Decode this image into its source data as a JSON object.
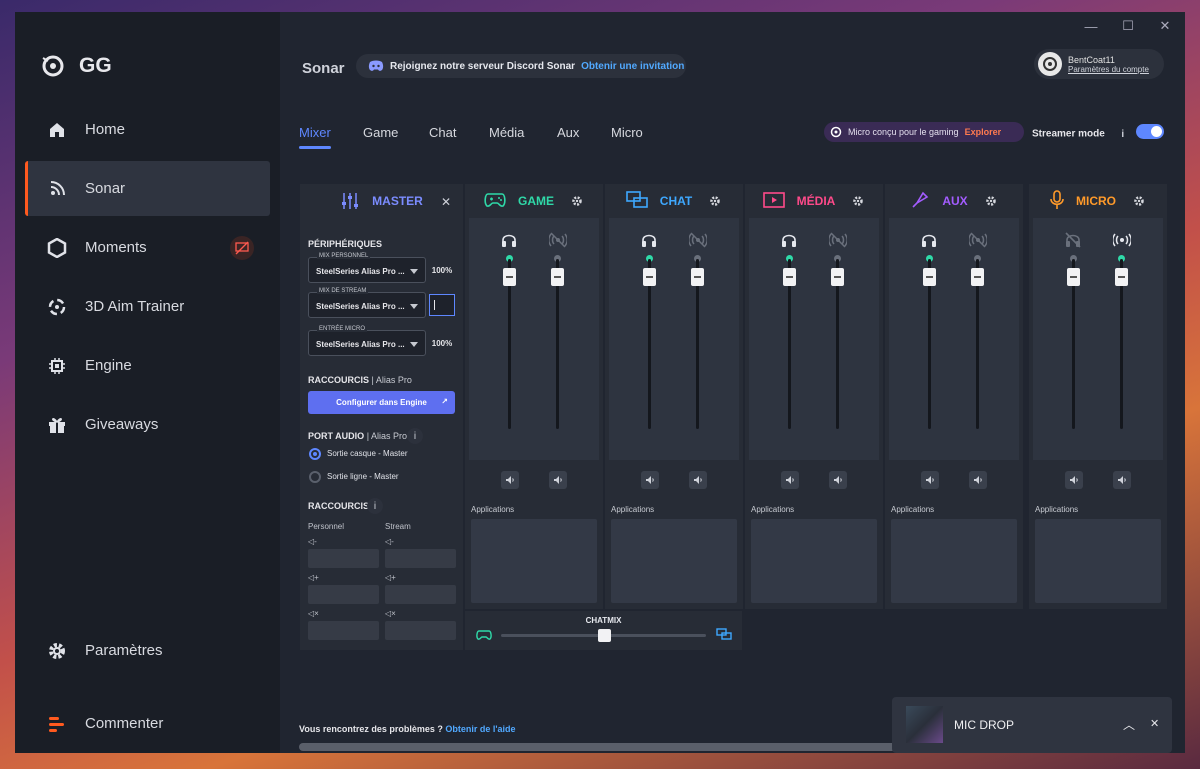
{
  "app": {
    "name": "GG",
    "window_controls": [
      "minimize",
      "maximize",
      "close"
    ]
  },
  "sidebar": {
    "items": [
      {
        "label": "Home",
        "icon": "home-icon"
      },
      {
        "label": "Sonar",
        "icon": "sonar-icon",
        "active": true
      },
      {
        "label": "Moments",
        "icon": "hexagon-icon"
      },
      {
        "label": "3D Aim Trainer",
        "icon": "crosshair-icon"
      },
      {
        "label": "Engine",
        "icon": "chip-icon"
      },
      {
        "label": "Giveaways",
        "icon": "gift-icon"
      }
    ],
    "bottom": [
      {
        "label": "Paramètres",
        "icon": "gear-icon"
      },
      {
        "label": "Commenter",
        "icon": "comment-icon"
      }
    ]
  },
  "header": {
    "title": "Sonar",
    "discord_text": "Rejoignez notre serveur Discord Sonar",
    "discord_link": "Obtenir une invitation",
    "user_name": "BentCoat11",
    "account_link": "Paramètres du compte"
  },
  "tabs": [
    "Mixer",
    "Game",
    "Chat",
    "Média",
    "Aux",
    "Micro"
  ],
  "promo": {
    "text": "Micro conçu pour le gaming",
    "link": "Explorer"
  },
  "streamer_mode": {
    "label": "Streamer mode",
    "info": "i",
    "enabled": true
  },
  "master": {
    "title": "MASTER",
    "peripherals_label": "PÉRIPHÉRIQUES",
    "devices": [
      {
        "caption": "MIX PERSONNEL",
        "value": "SteelSeries Alias Pro ...",
        "percent": "100%"
      },
      {
        "caption": "MIX DE STREAM",
        "value": "SteelSeries Alias Pro ...",
        "percent": ""
      },
      {
        "caption": "ENTRÉE MICRO",
        "value": "SteelSeries Alias Pro ...",
        "percent": "100%"
      }
    ],
    "shortcuts_label": "RACCOURCIS",
    "shortcuts_device": "| Alias Pro",
    "configure_button": "Configurer dans Engine",
    "audio_port_label": "PORT AUDIO",
    "audio_port_device": "| Alias Pro",
    "audio_port_info": "i",
    "ports": [
      {
        "label": "Sortie casque - Master",
        "selected": true
      },
      {
        "label": "Sortie ligne - Master",
        "selected": false
      }
    ],
    "hotkeys_label": "RACCOURCIS",
    "hotkeys_info": "i",
    "col_personal": "Personnel",
    "col_stream": "Stream",
    "hotkey_rows": [
      "vol-down",
      "vol-up",
      "mute"
    ],
    "hotkey_captions": [
      "◁-",
      "◁-",
      "◁+",
      "◁+",
      "◁×",
      "◁×"
    ]
  },
  "channels": [
    {
      "name": "GAME",
      "color": "#2fd9a8",
      "dots": [
        "#2fd9a8",
        "#6a707c"
      ],
      "icon": "gamepad-icon"
    },
    {
      "name": "CHAT",
      "color": "#3ea8ff",
      "dots": [
        "#2fd9a8",
        "#6a707c"
      ],
      "icon": "chat-icon"
    },
    {
      "name": "MÉDIA",
      "color": "#ff4a8a",
      "dots": [
        "#2fd9a8",
        "#6a707c"
      ],
      "icon": "media-icon"
    },
    {
      "name": "AUX",
      "color": "#a35cff",
      "dots": [
        "#2fd9a8",
        "#6a707c"
      ],
      "icon": "aux-icon"
    },
    {
      "name": "MICRO",
      "color": "#ff9a2a",
      "dots": [
        "#6a707c",
        "#2fd9a8"
      ],
      "icon": "microphone-icon"
    }
  ],
  "applications_label": "Applications",
  "chatmix": {
    "label": "CHATMIX",
    "value": 0.5
  },
  "help": {
    "text": "Vous rencontrez des problèmes ?",
    "link": "Obtenir de l'aide"
  },
  "notification": {
    "title": "MIC DROP"
  }
}
